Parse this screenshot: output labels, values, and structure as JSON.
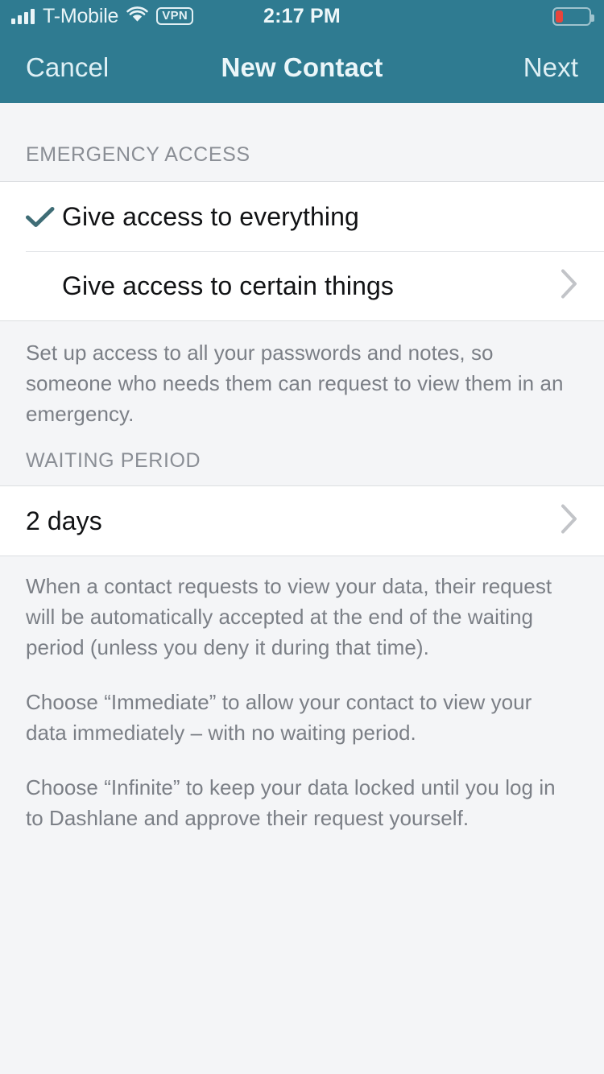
{
  "status_bar": {
    "carrier": "T-Mobile",
    "time": "2:17 PM",
    "vpn_label": "VPN",
    "signal_icon": "signal-bars-icon",
    "wifi_icon": "wifi-icon",
    "battery_icon": "battery-icon",
    "battery_level_percent": 20,
    "battery_color": "#e8453c",
    "bar_color": "#2f7b91"
  },
  "nav_bar": {
    "left_button": "Cancel",
    "title": "New Contact",
    "right_button": "Next",
    "background_color": "#2f7b91",
    "text_color": "#dff0f5"
  },
  "sections": {
    "emergency_access": {
      "header": "EMERGENCY ACCESS",
      "rows": [
        {
          "label": "Give access to everything",
          "selected": true,
          "check_icon": "checkmark-icon",
          "check_color": "#3f6d76",
          "has_chevron": false
        },
        {
          "label": "Give access to certain things",
          "selected": false,
          "has_chevron": true,
          "chevron_icon": "chevron-right-icon"
        }
      ],
      "footnote": "Set up access to all your passwords and notes, so someone who needs them can request to view them in an emergency."
    },
    "waiting_period": {
      "header": "WAITING PERIOD",
      "value": "2 days",
      "chevron_icon": "chevron-right-icon",
      "footnotes": [
        "When a contact requests to view your data, their request will be automatically accepted at the end of the waiting period (unless you deny it during that time).",
        "Choose “Immediate” to allow your contact to view your data immediately – with no waiting period.",
        "Choose “Infinite” to keep your data locked until you log in to Dashlane and approve their request yourself."
      ]
    }
  },
  "theme": {
    "page_background": "#f4f5f7",
    "cell_background": "#ffffff",
    "separator": "#dcdee1",
    "muted_text": "#7b7f86",
    "header_text": "#8a8e95"
  }
}
